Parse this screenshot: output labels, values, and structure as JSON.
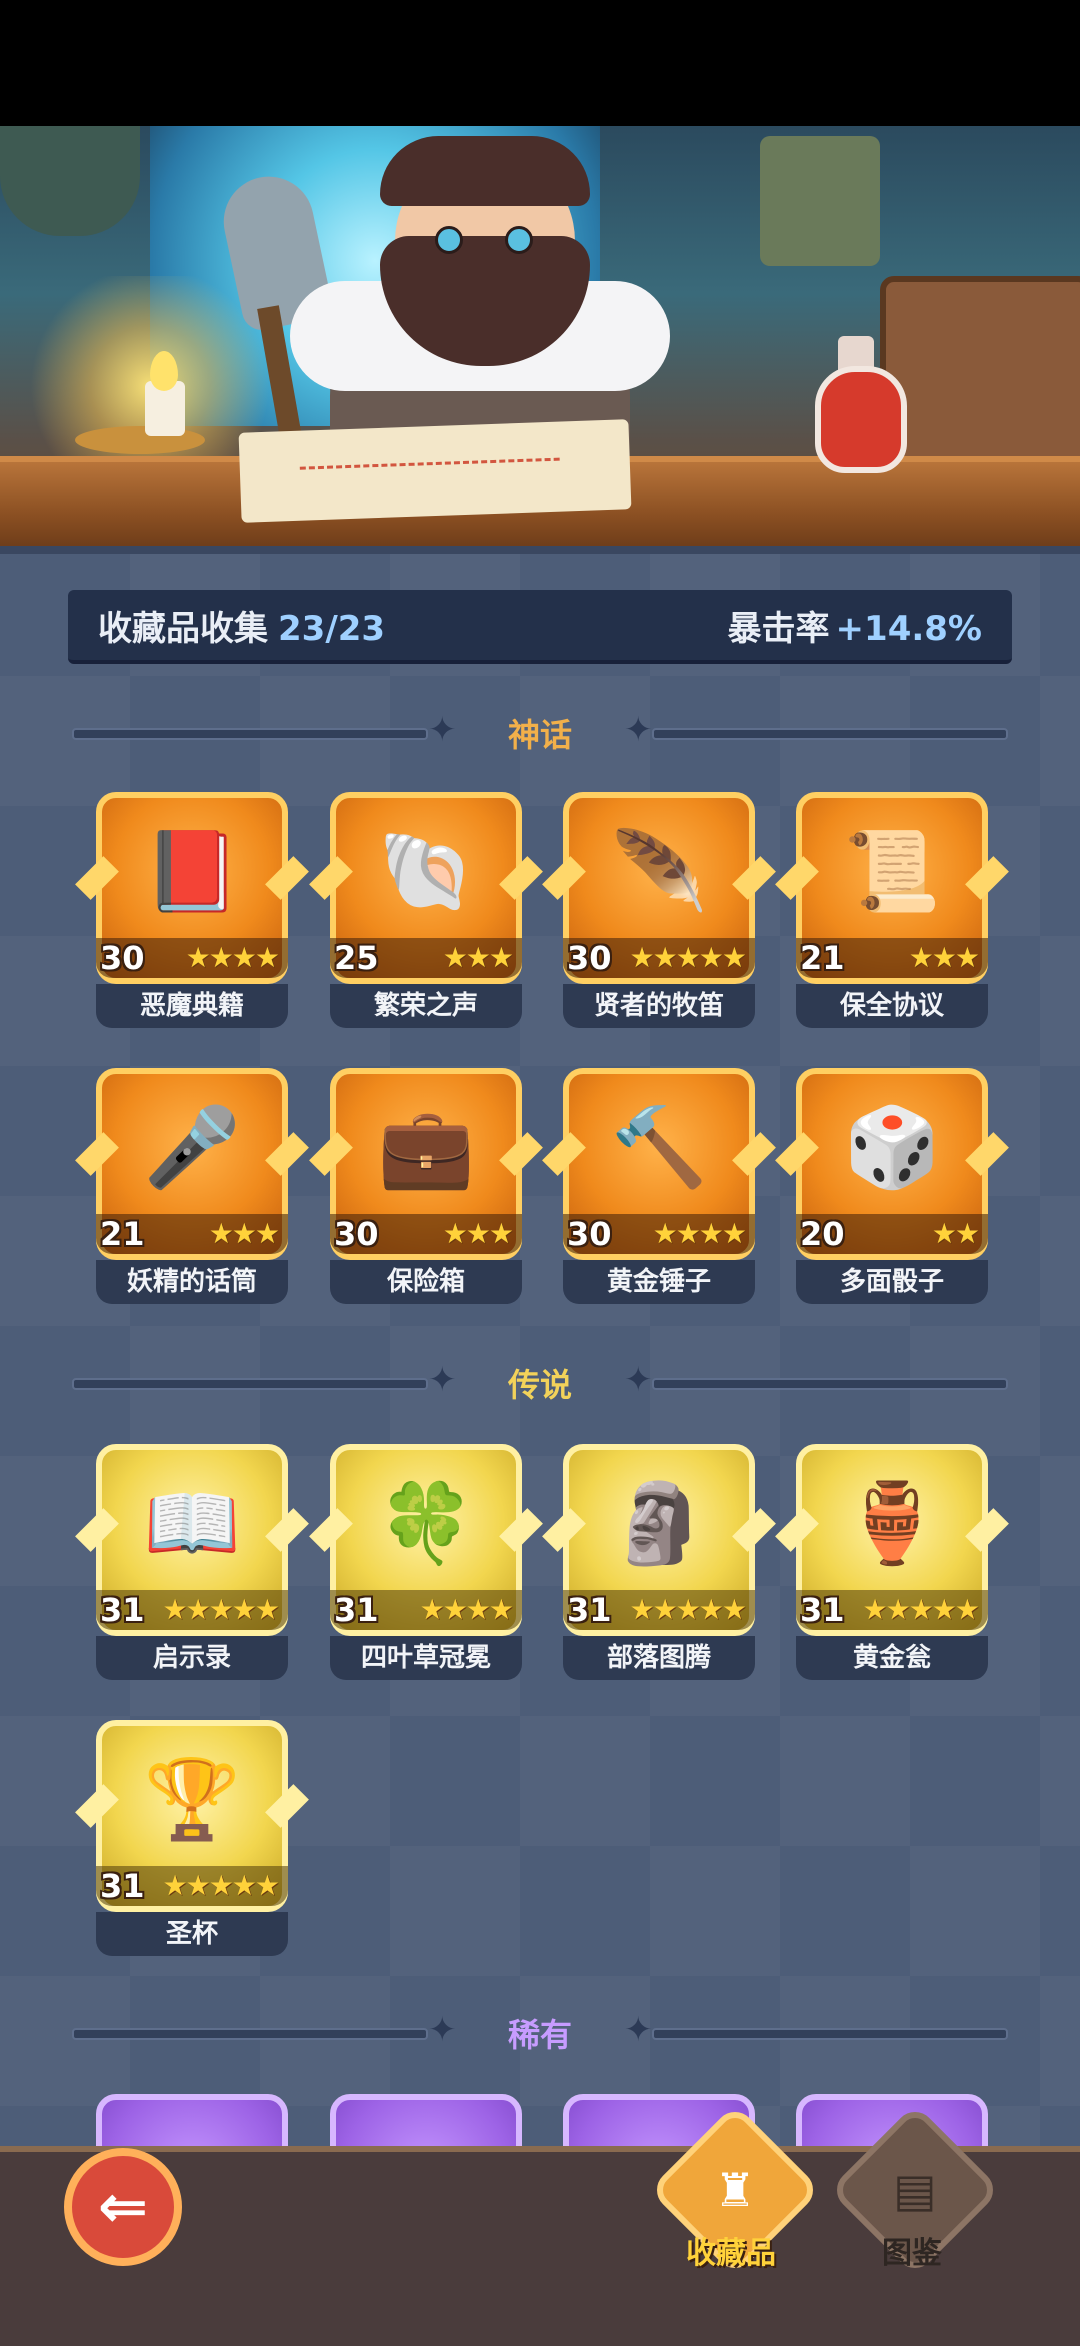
{
  "summary": {
    "label": "收藏品收集",
    "count": "23/23",
    "stat_label": "暴击率",
    "stat_value": "+14.8%"
  },
  "sections": {
    "mythic": "神话",
    "legend": "传说",
    "rare": "稀有"
  },
  "mythic_items": [
    {
      "name": "恶魔典籍",
      "level": "30",
      "stars": "★★★★",
      "icon": "book-eye-icon"
    },
    {
      "name": "繁荣之声",
      "level": "25",
      "stars": "★★★",
      "icon": "shell-orb-icon"
    },
    {
      "name": "贤者的牧笛",
      "level": "30",
      "stars": "★★★★★",
      "icon": "flute-icon"
    },
    {
      "name": "保全协议",
      "level": "21",
      "stars": "★★★",
      "icon": "scroll-contract-icon"
    },
    {
      "name": "妖精的话筒",
      "level": "21",
      "stars": "★★★",
      "icon": "fairy-mic-icon"
    },
    {
      "name": "保险箱",
      "level": "30",
      "stars": "★★★",
      "icon": "gold-chest-icon"
    },
    {
      "name": "黄金锤子",
      "level": "30",
      "stars": "★★★★",
      "icon": "hammer-icon"
    },
    {
      "name": "多面骰子",
      "level": "20",
      "stars": "★★",
      "icon": "dice-icon"
    }
  ],
  "legend_items": [
    {
      "name": "启示录",
      "level": "31",
      "stars": "★★★★★",
      "icon": "open-book-icon"
    },
    {
      "name": "四叶草冠冕",
      "level": "31",
      "stars": "★★★★",
      "icon": "clover-crown-icon"
    },
    {
      "name": "部落图腾",
      "level": "31",
      "stars": "★★★★★",
      "icon": "totem-icon"
    },
    {
      "name": "黄金瓮",
      "level": "31",
      "stars": "★★★★★",
      "icon": "urn-icon"
    },
    {
      "name": "圣杯",
      "level": "31",
      "stars": "★★★★★",
      "icon": "grail-icon"
    }
  ],
  "nav": {
    "collection_label": "收藏品",
    "codex_label": "图鉴"
  },
  "colors": {
    "mythic_title": "#f2b04a",
    "legend_title": "#f2d25a",
    "rare_title": "#c79cff"
  }
}
